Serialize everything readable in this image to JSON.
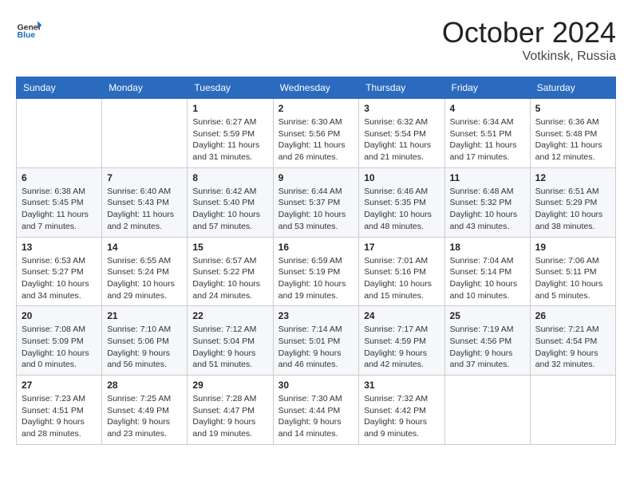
{
  "header": {
    "logo": {
      "general": "General",
      "blue": "Blue",
      "icon": "▶"
    },
    "title": "October 2024",
    "location": "Votkinsk, Russia"
  },
  "weekdays": [
    "Sunday",
    "Monday",
    "Tuesday",
    "Wednesday",
    "Thursday",
    "Friday",
    "Saturday"
  ],
  "weeks": [
    [
      {
        "day": null
      },
      {
        "day": null
      },
      {
        "day": "1",
        "sunrise": "6:27 AM",
        "sunset": "5:59 PM",
        "daylight": "11 hours and 31 minutes."
      },
      {
        "day": "2",
        "sunrise": "6:30 AM",
        "sunset": "5:56 PM",
        "daylight": "11 hours and 26 minutes."
      },
      {
        "day": "3",
        "sunrise": "6:32 AM",
        "sunset": "5:54 PM",
        "daylight": "11 hours and 21 minutes."
      },
      {
        "day": "4",
        "sunrise": "6:34 AM",
        "sunset": "5:51 PM",
        "daylight": "11 hours and 17 minutes."
      },
      {
        "day": "5",
        "sunrise": "6:36 AM",
        "sunset": "5:48 PM",
        "daylight": "11 hours and 12 minutes."
      }
    ],
    [
      {
        "day": "6",
        "sunrise": "6:38 AM",
        "sunset": "5:45 PM",
        "daylight": "11 hours and 7 minutes."
      },
      {
        "day": "7",
        "sunrise": "6:40 AM",
        "sunset": "5:43 PM",
        "daylight": "11 hours and 2 minutes."
      },
      {
        "day": "8",
        "sunrise": "6:42 AM",
        "sunset": "5:40 PM",
        "daylight": "10 hours and 57 minutes."
      },
      {
        "day": "9",
        "sunrise": "6:44 AM",
        "sunset": "5:37 PM",
        "daylight": "10 hours and 53 minutes."
      },
      {
        "day": "10",
        "sunrise": "6:46 AM",
        "sunset": "5:35 PM",
        "daylight": "10 hours and 48 minutes."
      },
      {
        "day": "11",
        "sunrise": "6:48 AM",
        "sunset": "5:32 PM",
        "daylight": "10 hours and 43 minutes."
      },
      {
        "day": "12",
        "sunrise": "6:51 AM",
        "sunset": "5:29 PM",
        "daylight": "10 hours and 38 minutes."
      }
    ],
    [
      {
        "day": "13",
        "sunrise": "6:53 AM",
        "sunset": "5:27 PM",
        "daylight": "10 hours and 34 minutes."
      },
      {
        "day": "14",
        "sunrise": "6:55 AM",
        "sunset": "5:24 PM",
        "daylight": "10 hours and 29 minutes."
      },
      {
        "day": "15",
        "sunrise": "6:57 AM",
        "sunset": "5:22 PM",
        "daylight": "10 hours and 24 minutes."
      },
      {
        "day": "16",
        "sunrise": "6:59 AM",
        "sunset": "5:19 PM",
        "daylight": "10 hours and 19 minutes."
      },
      {
        "day": "17",
        "sunrise": "7:01 AM",
        "sunset": "5:16 PM",
        "daylight": "10 hours and 15 minutes."
      },
      {
        "day": "18",
        "sunrise": "7:04 AM",
        "sunset": "5:14 PM",
        "daylight": "10 hours and 10 minutes."
      },
      {
        "day": "19",
        "sunrise": "7:06 AM",
        "sunset": "5:11 PM",
        "daylight": "10 hours and 5 minutes."
      }
    ],
    [
      {
        "day": "20",
        "sunrise": "7:08 AM",
        "sunset": "5:09 PM",
        "daylight": "10 hours and 0 minutes."
      },
      {
        "day": "21",
        "sunrise": "7:10 AM",
        "sunset": "5:06 PM",
        "daylight": "9 hours and 56 minutes."
      },
      {
        "day": "22",
        "sunrise": "7:12 AM",
        "sunset": "5:04 PM",
        "daylight": "9 hours and 51 minutes."
      },
      {
        "day": "23",
        "sunrise": "7:14 AM",
        "sunset": "5:01 PM",
        "daylight": "9 hours and 46 minutes."
      },
      {
        "day": "24",
        "sunrise": "7:17 AM",
        "sunset": "4:59 PM",
        "daylight": "9 hours and 42 minutes."
      },
      {
        "day": "25",
        "sunrise": "7:19 AM",
        "sunset": "4:56 PM",
        "daylight": "9 hours and 37 minutes."
      },
      {
        "day": "26",
        "sunrise": "7:21 AM",
        "sunset": "4:54 PM",
        "daylight": "9 hours and 32 minutes."
      }
    ],
    [
      {
        "day": "27",
        "sunrise": "7:23 AM",
        "sunset": "4:51 PM",
        "daylight": "9 hours and 28 minutes."
      },
      {
        "day": "28",
        "sunrise": "7:25 AM",
        "sunset": "4:49 PM",
        "daylight": "9 hours and 23 minutes."
      },
      {
        "day": "29",
        "sunrise": "7:28 AM",
        "sunset": "4:47 PM",
        "daylight": "9 hours and 19 minutes."
      },
      {
        "day": "30",
        "sunrise": "7:30 AM",
        "sunset": "4:44 PM",
        "daylight": "9 hours and 14 minutes."
      },
      {
        "day": "31",
        "sunrise": "7:32 AM",
        "sunset": "4:42 PM",
        "daylight": "9 hours and 9 minutes."
      },
      {
        "day": null
      },
      {
        "day": null
      }
    ]
  ]
}
